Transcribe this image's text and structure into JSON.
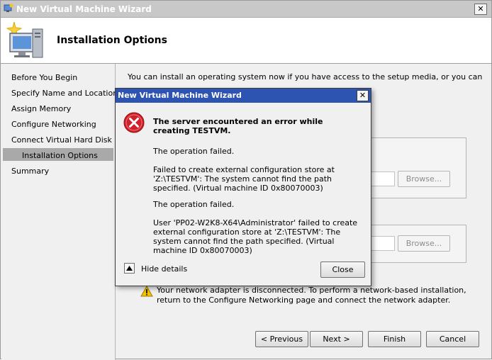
{
  "window": {
    "title": "New Virtual Machine Wizard",
    "close_glyph": "✕",
    "page_title": "Installation Options"
  },
  "nav": {
    "items": [
      {
        "label": "Before You Begin"
      },
      {
        "label": "Specify Name and Location"
      },
      {
        "label": "Assign Memory"
      },
      {
        "label": "Configure Networking"
      },
      {
        "label": "Connect Virtual Hard Disk"
      },
      {
        "label": "Installation Options"
      },
      {
        "label": "Summary"
      }
    ],
    "selected_index": 5
  },
  "content": {
    "intro": "You can install an operating system now if you have access to the setup media, or you can install it later.",
    "browse_label_1": "Browse...",
    "browse_label_2": "Browse...",
    "warning_text": "Your network adapter is disconnected. To perform a network-based installation, return to the Configure Networking page and connect the network adapter."
  },
  "footer": {
    "previous": "< Previous",
    "next": "Next >",
    "finish": "Finish",
    "cancel": "Cancel"
  },
  "dialog": {
    "title": "New Virtual Machine Wizard",
    "close_glyph": "✕",
    "heading": "The server encountered an error while creating TESTVM.",
    "para1": "The operation failed.",
    "para2": "Failed to create external configuration store at 'Z:\\TESTVM': The system cannot find the path specified. (Virtual machine ID 0x80070003)",
    "para3": "The operation failed.",
    "para4": "User 'PP02-W2K8-X64\\Administrator' failed to create external configuration store at 'Z:\\TESTVM': The system cannot find the path specified. (Virtual machine ID 0x80070003)",
    "hide_details": "Hide details",
    "close_button": "Close"
  },
  "colors": {
    "dialog_title_bg": "#2d54b0",
    "error_red": "#d2202a",
    "warning_yellow": "#f5c400",
    "nav_selected": "#a9a9a9"
  }
}
